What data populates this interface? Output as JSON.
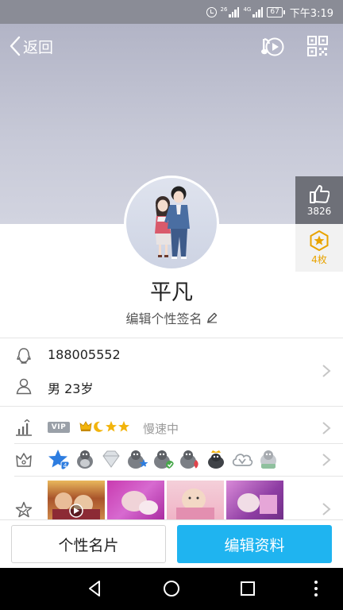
{
  "status_bar": {
    "network_label": "26",
    "network_label_2": "4G",
    "battery": "67",
    "time": "下午3:19"
  },
  "header": {
    "back_label": "返回",
    "back_icon": "chevron-left-icon",
    "music_icon": "music-note-play-icon",
    "qr_icon": "qr-code-icon"
  },
  "side": {
    "like_count": "3826",
    "like_icon": "thumbs-up-icon",
    "badge_count": "4枚",
    "badge_icon": "star-medal-icon"
  },
  "profile": {
    "nickname": "平凡",
    "signature_placeholder": "编辑个性签名",
    "edit_icon": "pencil-icon"
  },
  "info": {
    "qq_number": "188005552",
    "gender_age": "男  23岁",
    "qq_icon": "penguin-icon",
    "person_icon": "person-icon"
  },
  "vip": {
    "tag": "VIP",
    "level_icons": [
      "crown",
      "moon",
      "star",
      "star"
    ],
    "status": "慢速中",
    "level_chart_icon": "level-bars-icon"
  },
  "medals": {
    "icon": "crown-gift-icon",
    "items": [
      "qq-star-medal",
      "penguin-medal",
      "diamond-medal",
      "penguin-star-medal",
      "penguin-check-medal",
      "penguin-flame-medal",
      "penguin-crown-medal",
      "cloud-medal",
      "penguin-label-medal"
    ]
  },
  "album": {
    "icon": "star-album-icon",
    "photos": [
      "photo-children",
      "photo-baby-purple",
      "photo-baby-crib",
      "photo-baby-pink"
    ]
  },
  "actions": {
    "card_label": "个性名片",
    "edit_label": "编辑资料"
  },
  "colors": {
    "accent": "#1fb4f0",
    "cover": "#c4c6d6",
    "like_bg": "#6e7078",
    "badge_color": "#e8a300"
  }
}
